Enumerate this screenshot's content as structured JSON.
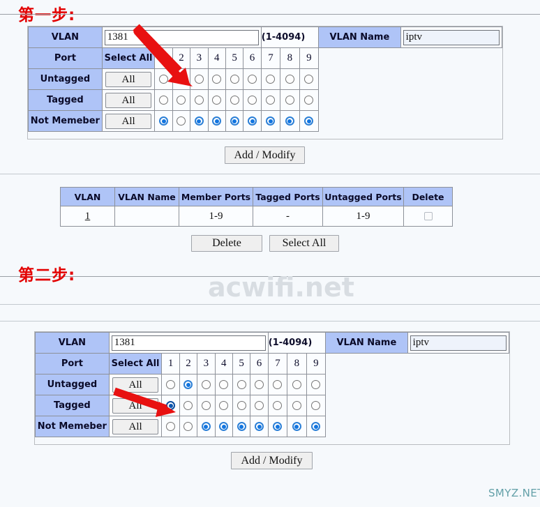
{
  "page": {
    "bg_color": "#f6f9fc",
    "accent_red": "#e30000",
    "header_blue": "#afc4f7",
    "radio_blue": "#1275e0"
  },
  "steps": [
    {
      "label": "第一步:"
    },
    {
      "label": "第二步:"
    }
  ],
  "watermarks": {
    "center": "acwifi.net",
    "corner": "SMYZ.NET"
  },
  "vlan_form_1": {
    "vlan_label": "VLAN",
    "vlan_value": "1381",
    "range_hint": "(1-4094)",
    "vlan_name_label": "VLAN Name",
    "vlan_name_value": "iptv",
    "port_label": "Port",
    "select_all_label": "Select All",
    "all_button_label": "All",
    "ports": [
      "1",
      "2",
      "3",
      "4",
      "5",
      "6",
      "7",
      "8",
      "9"
    ],
    "rows": [
      {
        "label": "Untagged",
        "selected": [
          false,
          true,
          false,
          false,
          false,
          false,
          false,
          false,
          false
        ]
      },
      {
        "label": "Tagged",
        "selected": [
          false,
          false,
          false,
          false,
          false,
          false,
          false,
          false,
          false
        ]
      },
      {
        "label": "Not Memeber",
        "selected": [
          true,
          false,
          true,
          true,
          true,
          true,
          true,
          true,
          true
        ]
      }
    ],
    "submit_label": "Add / Modify"
  },
  "vlan_list": {
    "headers": [
      "VLAN",
      "VLAN Name",
      "Member Ports",
      "Tagged Ports",
      "Untagged Ports",
      "Delete"
    ],
    "rows": [
      {
        "vlan": "1",
        "vlan_name": "",
        "member_ports": "1-9",
        "tagged_ports": "-",
        "untagged_ports": "1-9",
        "delete_checked": false
      }
    ],
    "delete_label": "Delete",
    "select_all_label": "Select All"
  },
  "vlan_form_2": {
    "vlan_label": "VLAN",
    "vlan_value": "1381",
    "range_hint": "(1-4094)",
    "vlan_name_label": "VLAN Name",
    "vlan_name_value": "iptv",
    "port_label": "Port",
    "select_all_label": "Select All",
    "all_button_label": "All",
    "ports": [
      "1",
      "2",
      "3",
      "4",
      "5",
      "6",
      "7",
      "8",
      "9"
    ],
    "rows": [
      {
        "label": "Untagged",
        "selected": [
          false,
          true,
          false,
          false,
          false,
          false,
          false,
          false,
          false
        ]
      },
      {
        "label": "Tagged",
        "selected": [
          true,
          false,
          false,
          false,
          false,
          false,
          false,
          false,
          false
        ]
      },
      {
        "label": "Not Memeber",
        "selected": [
          false,
          false,
          true,
          true,
          true,
          true,
          true,
          true,
          true
        ]
      }
    ],
    "submit_label": "Add / Modify"
  },
  "annotations": [
    {
      "name": "arrow-to-untagged-port2",
      "color": "#e81111"
    },
    {
      "name": "arrow-to-tagged-port1",
      "color": "#e81111"
    }
  ]
}
